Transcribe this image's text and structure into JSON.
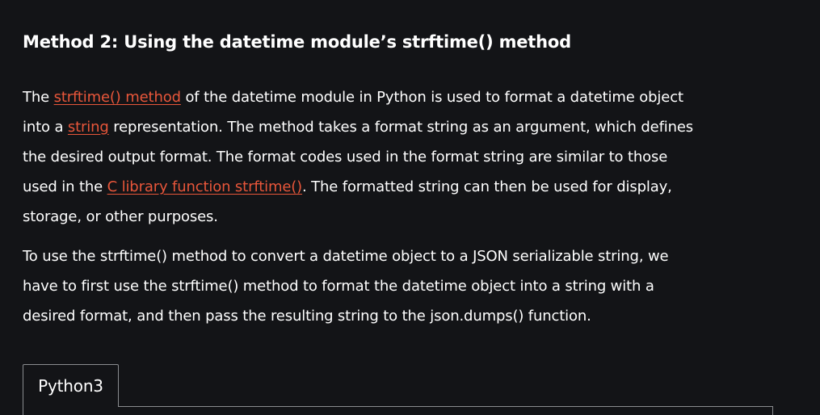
{
  "article": {
    "heading": "Method 2:  Using the datetime module’s strftime() method",
    "p1": {
      "l1": {
        "a": "The ",
        "link": "strftime() method",
        "b": " of the datetime module in Python is used to format a datetime object"
      },
      "l2": {
        "a": "into a ",
        "link": "string",
        "b": " representation. The method takes a format string as an argument, which defines"
      },
      "l3": "the desired output format. The format codes used in the format string are similar to those",
      "l4": {
        "a": "used in the ",
        "link": "C library function strftime()",
        "b": ". The formatted string can then be used for display,"
      },
      "l5": "storage, or other purposes."
    },
    "p2": {
      "l1": "To use the strftime() method to convert a datetime object to a JSON serializable string, we",
      "l2": "have to first use the strftime() method to format the datetime object into a string with a",
      "l3": "desired format, and then pass the resulting string to the json.dumps() function."
    }
  },
  "code_tabs": {
    "active_tab": "Python3"
  },
  "colors": {
    "background": "#131417",
    "text": "#ffffff",
    "link": "#e8563a",
    "border": "#8a8c8f"
  }
}
